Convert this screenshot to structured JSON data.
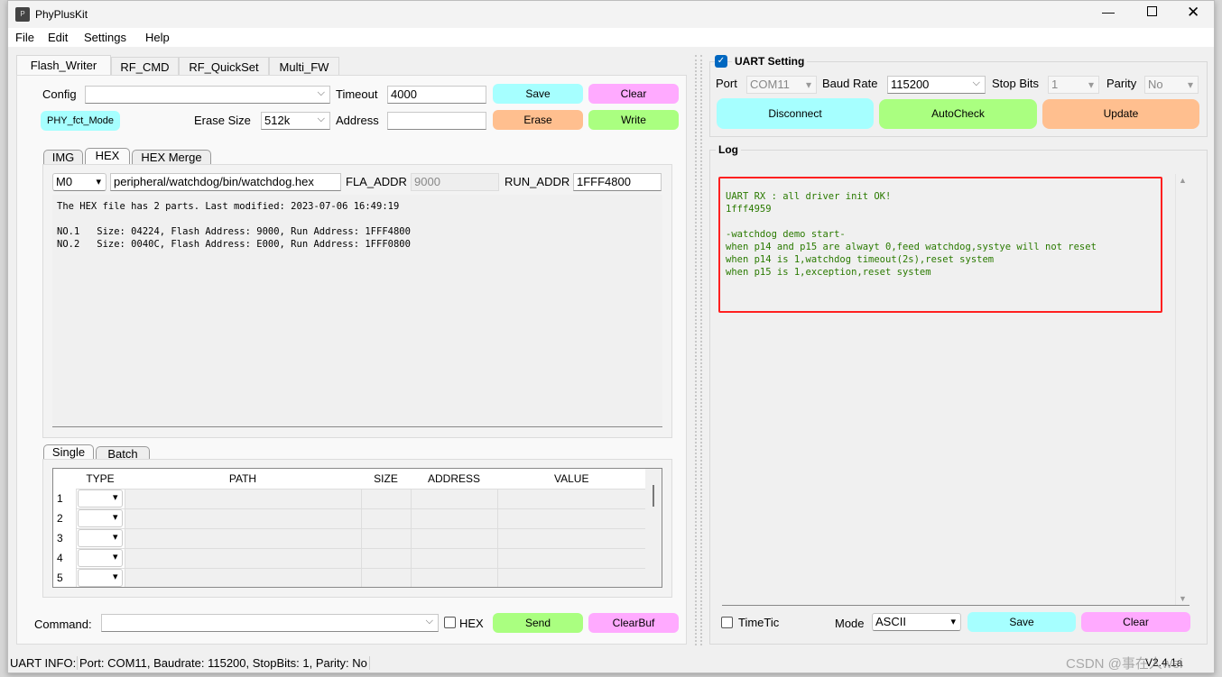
{
  "window": {
    "title": "PhyPlusKit",
    "app_icon": "app-logo-icon"
  },
  "menu": [
    "File",
    "Edit",
    "Settings",
    "Help"
  ],
  "tabs": [
    "Flash_Writer",
    "RF_CMD",
    "RF_QuickSet",
    "Multi_FW"
  ],
  "flash": {
    "config_label": "Config",
    "config_value": "",
    "timeout_label": "Timeout",
    "timeout_value": "4000",
    "save": "Save",
    "clear": "Clear",
    "mode_badge": "PHY_fct_Mode",
    "erase_size_label": "Erase Size",
    "erase_size_value": "512k",
    "address_label": "Address",
    "address_value": "",
    "erase": "Erase",
    "write": "Write"
  },
  "subtabs": [
    "IMG",
    "HEX",
    "HEX Merge"
  ],
  "hex": {
    "core": "M0",
    "path": "peripheral/watchdog/bin/watchdog.hex",
    "fla_label": "FLA_ADDR",
    "fla_value": "9000",
    "run_label": "RUN_ADDR",
    "run_value": "1FFF4800",
    "lines": [
      "The HEX file has 2 parts. Last modified: 2023-07-06 16:49:19",
      "",
      "NO.1   Size: 04224, Flash Address: 9000, Run Address: 1FFF4800",
      "NO.2   Size: 0040C, Flash Address: E000, Run Address: 1FFF0800"
    ]
  },
  "single_tabs": [
    "Single",
    "Batch"
  ],
  "table": {
    "columns": [
      "TYPE",
      "PATH",
      "SIZE",
      "ADDRESS",
      "VALUE"
    ],
    "rows": [
      "1",
      "2",
      "3",
      "4",
      "5"
    ]
  },
  "command": {
    "label": "Command:",
    "value": "",
    "hex_label": "HEX",
    "hex_checked": false,
    "send": "Send",
    "clearbuf": "ClearBuf"
  },
  "uart": {
    "title": "UART Setting",
    "enabled": true,
    "port_label": "Port",
    "port_value": "COM11",
    "baud_label": "Baud Rate",
    "baud_value": "115200",
    "stop_label": "Stop Bits",
    "stop_value": "1",
    "parity_label": "Parity",
    "parity_value": "No",
    "disconnect": "Disconnect",
    "autocheck": "AutoCheck",
    "update": "Update"
  },
  "log": {
    "title": "Log",
    "lines": [
      "UART RX : all driver init OK!",
      "1fff4959",
      "",
      "-watchdog demo start-",
      "when p14 and p15 are alwayt 0,feed watchdog,systye will not reset",
      "when p14 is 1,watchdog timeout(2s),reset system",
      "when p15 is 1,exception,reset system"
    ],
    "timetic_label": "TimeTic",
    "timetic_checked": false,
    "mode_label": "Mode",
    "mode_value": "ASCII",
    "save": "Save",
    "clear": "Clear"
  },
  "status": {
    "label": "UART INFO:",
    "info": "Port: COM11, Baudrate: 115200, StopBits: 1, Parity: No",
    "version": "V2.4.1a"
  },
  "watermark": "CSDN @事在人wei",
  "colors": {
    "cyan": "#a6ffff",
    "pink": "#ffaaff",
    "orange": "#ffbf8f",
    "green": "#aaff80",
    "log_text": "#2a7a00",
    "highlight": "#ff2020"
  }
}
